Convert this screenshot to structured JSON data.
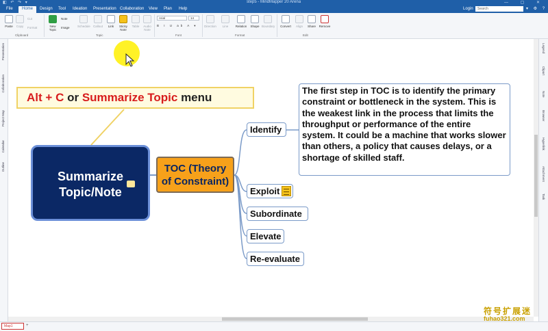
{
  "window": {
    "title": "step5 - MindMapper 20 Arena",
    "quick_access": "◧ ↶ ↷ ▾",
    "controls": "— ▢ ✕"
  },
  "menu": {
    "tabs": [
      "File",
      "Home",
      "Design",
      "Tool",
      "Ideation",
      "Presentation",
      "Collaboration",
      "View",
      "Plan",
      "Help"
    ],
    "login": "Login",
    "search_placeholder": "Search",
    "right_icons": "▾ ⚙ ?"
  },
  "ribbon": {
    "paste": "Paste",
    "copy": "Copy",
    "cut": "Cut",
    "format": "Format",
    "clipboard_group": "Clipboard",
    "new_topic": "New Topic",
    "note": "Note",
    "image": "Image",
    "schedule": "Schedule",
    "callout": "Callout",
    "link": "Link",
    "sticky_note": "Sticky Note",
    "table": "Table",
    "audio_note": "Audio Note",
    "topic_group": "Topic",
    "font_name": "Arial",
    "font_size": "14",
    "font_group": "Font",
    "direction": "Direction",
    "line": "Line",
    "relation": "Relation",
    "shape": "Shape",
    "boundary": "Boundary",
    "format_group": "Format",
    "convert": "Convert",
    "align": "Align",
    "share": "Share",
    "remove": "Remove",
    "edit_group": "Edit"
  },
  "left_sidebar": [
    "Presentation",
    "Collaboration",
    "Project Map",
    "Calendar",
    "Outline"
  ],
  "right_sidebar": [
    "Legend",
    "Clipart",
    "Note",
    "Browser",
    "Hyperlink",
    "Attachment",
    "Task"
  ],
  "canvas": {
    "callout": {
      "part1": "Alt",
      "part2": "+",
      "part3": "C",
      "part4": "or",
      "part5": "Summarize Topic",
      "part6": "menu"
    },
    "central_topic": {
      "line1": "Summarize",
      "line2": "Topic/Note"
    },
    "main_topic": {
      "line1": "TOC (Theory",
      "line2": "of Constraint)"
    },
    "subtopics": {
      "identify": "Identify",
      "exploit": "Exploit",
      "subordinate": "Subordinate",
      "elevate": "Elevate",
      "reevaluate": "Re-evaluate"
    },
    "note_text": "The first step in TOC is to identify the primary constraint or bottleneck in the system. This is the weakest link in the process that limits the throughput or performance of the entire system. It could be a machine that works slower than others, a policy that causes delays, or a shortage of skilled staff."
  },
  "status": {
    "doc_tab": "Map1",
    "add_tab": "+"
  },
  "watermark": {
    "line1": "符号扩展迷",
    "line2": "fuhao321.com"
  },
  "colors": {
    "title_bar": "#1f5fa8",
    "central_fill": "#0b2865",
    "main_topic_fill": "#f7a11a",
    "callout_fill": "#fffbe0",
    "callout_red": "#d81d1d",
    "connector": "#7a9ac8",
    "callout_line": "#f0d264"
  }
}
